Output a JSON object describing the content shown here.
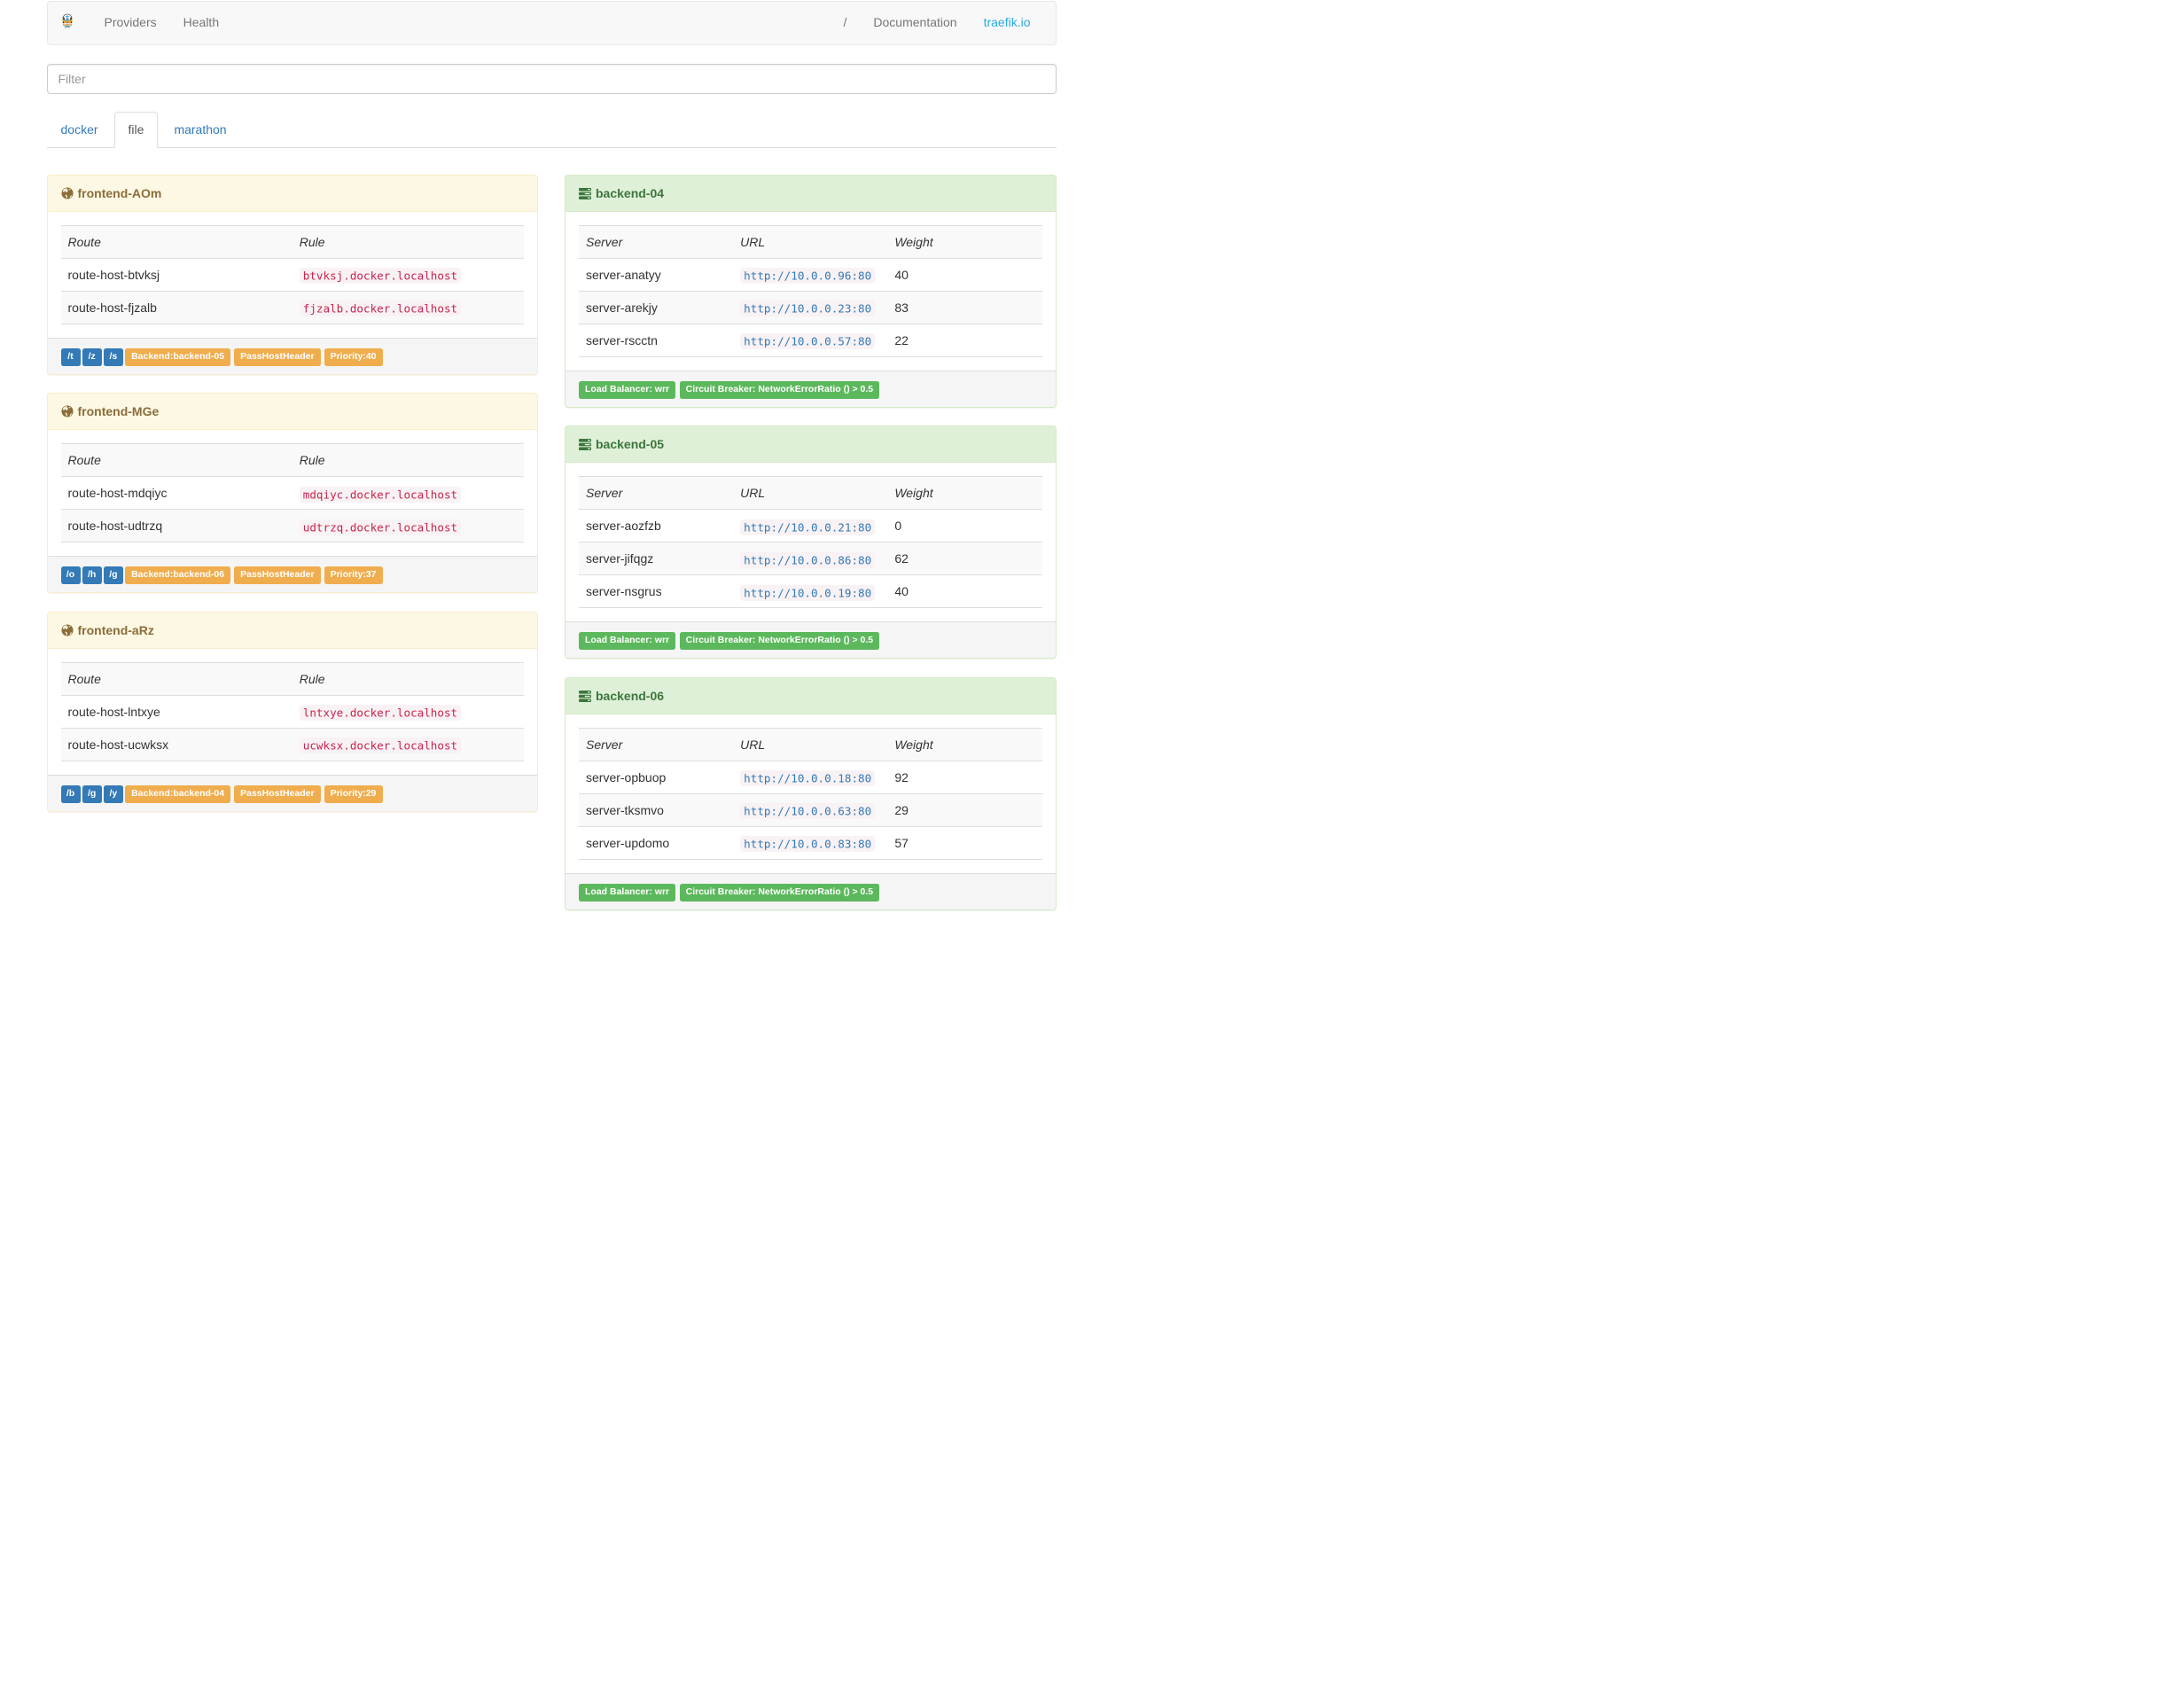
{
  "navbar": {
    "brand_icon": "traefik-gopher-logo",
    "left_items": [
      {
        "label": "Providers"
      },
      {
        "label": "Health"
      }
    ],
    "right_items": [
      {
        "label": "/"
      },
      {
        "label": "Documentation"
      },
      {
        "label": "traefik.io",
        "brand": true
      }
    ]
  },
  "filter": {
    "placeholder": "Filter",
    "value": ""
  },
  "tabs": [
    {
      "label": "docker",
      "active": false
    },
    {
      "label": "file",
      "active": true
    },
    {
      "label": "marathon",
      "active": false
    }
  ],
  "frontend_table_headers": [
    "Route",
    "Rule"
  ],
  "backend_table_headers": [
    "Server",
    "URL",
    "Weight"
  ],
  "frontends": [
    {
      "title": "frontend-AOm",
      "icon": "globe-icon",
      "routes": [
        {
          "route": "route-host-btvksj",
          "rule": "btvksj.docker.localhost"
        },
        {
          "route": "route-host-fjzalb",
          "rule": "fjzalb.docker.localhost"
        }
      ],
      "route_badges": [
        "/t",
        "/z",
        "/s"
      ],
      "detail_badges": [
        "Backend:backend-05",
        "PassHostHeader",
        "Priority:40"
      ]
    },
    {
      "title": "frontend-MGe",
      "icon": "globe-icon",
      "routes": [
        {
          "route": "route-host-mdqiyc",
          "rule": "mdqiyc.docker.localhost"
        },
        {
          "route": "route-host-udtrzq",
          "rule": "udtrzq.docker.localhost"
        }
      ],
      "route_badges": [
        "/o",
        "/h",
        "/g"
      ],
      "detail_badges": [
        "Backend:backend-06",
        "PassHostHeader",
        "Priority:37"
      ]
    },
    {
      "title": "frontend-aRz",
      "icon": "globe-icon",
      "routes": [
        {
          "route": "route-host-lntxye",
          "rule": "lntxye.docker.localhost"
        },
        {
          "route": "route-host-ucwksx",
          "rule": "ucwksx.docker.localhost"
        }
      ],
      "route_badges": [
        "/b",
        "/g",
        "/y"
      ],
      "detail_badges": [
        "Backend:backend-04",
        "PassHostHeader",
        "Priority:29"
      ]
    }
  ],
  "backends": [
    {
      "title": "backend-04",
      "icon": "servers-icon",
      "servers": [
        {
          "server": "server-anatyy",
          "url": "http://10.0.0.96:80",
          "weight": "40"
        },
        {
          "server": "server-arekjy",
          "url": "http://10.0.0.23:80",
          "weight": "83"
        },
        {
          "server": "server-rscctn",
          "url": "http://10.0.0.57:80",
          "weight": "22"
        }
      ],
      "footer_badges": [
        "Load Balancer: wrr",
        "Circuit Breaker: NetworkErrorRatio () > 0.5"
      ]
    },
    {
      "title": "backend-05",
      "icon": "servers-icon",
      "servers": [
        {
          "server": "server-aozfzb",
          "url": "http://10.0.0.21:80",
          "weight": "0"
        },
        {
          "server": "server-jifqgz",
          "url": "http://10.0.0.86:80",
          "weight": "62"
        },
        {
          "server": "server-nsgrus",
          "url": "http://10.0.0.19:80",
          "weight": "40"
        }
      ],
      "footer_badges": [
        "Load Balancer: wrr",
        "Circuit Breaker: NetworkErrorRatio () > 0.5"
      ]
    },
    {
      "title": "backend-06",
      "icon": "servers-icon",
      "servers": [
        {
          "server": "server-opbuop",
          "url": "http://10.0.0.18:80",
          "weight": "92"
        },
        {
          "server": "server-tksmvo",
          "url": "http://10.0.0.63:80",
          "weight": "29"
        },
        {
          "server": "server-updomo",
          "url": "http://10.0.0.83:80",
          "weight": "57"
        }
      ],
      "footer_badges": [
        "Load Balancer: wrr",
        "Circuit Breaker: NetworkErrorRatio () > 0.5"
      ]
    }
  ]
}
